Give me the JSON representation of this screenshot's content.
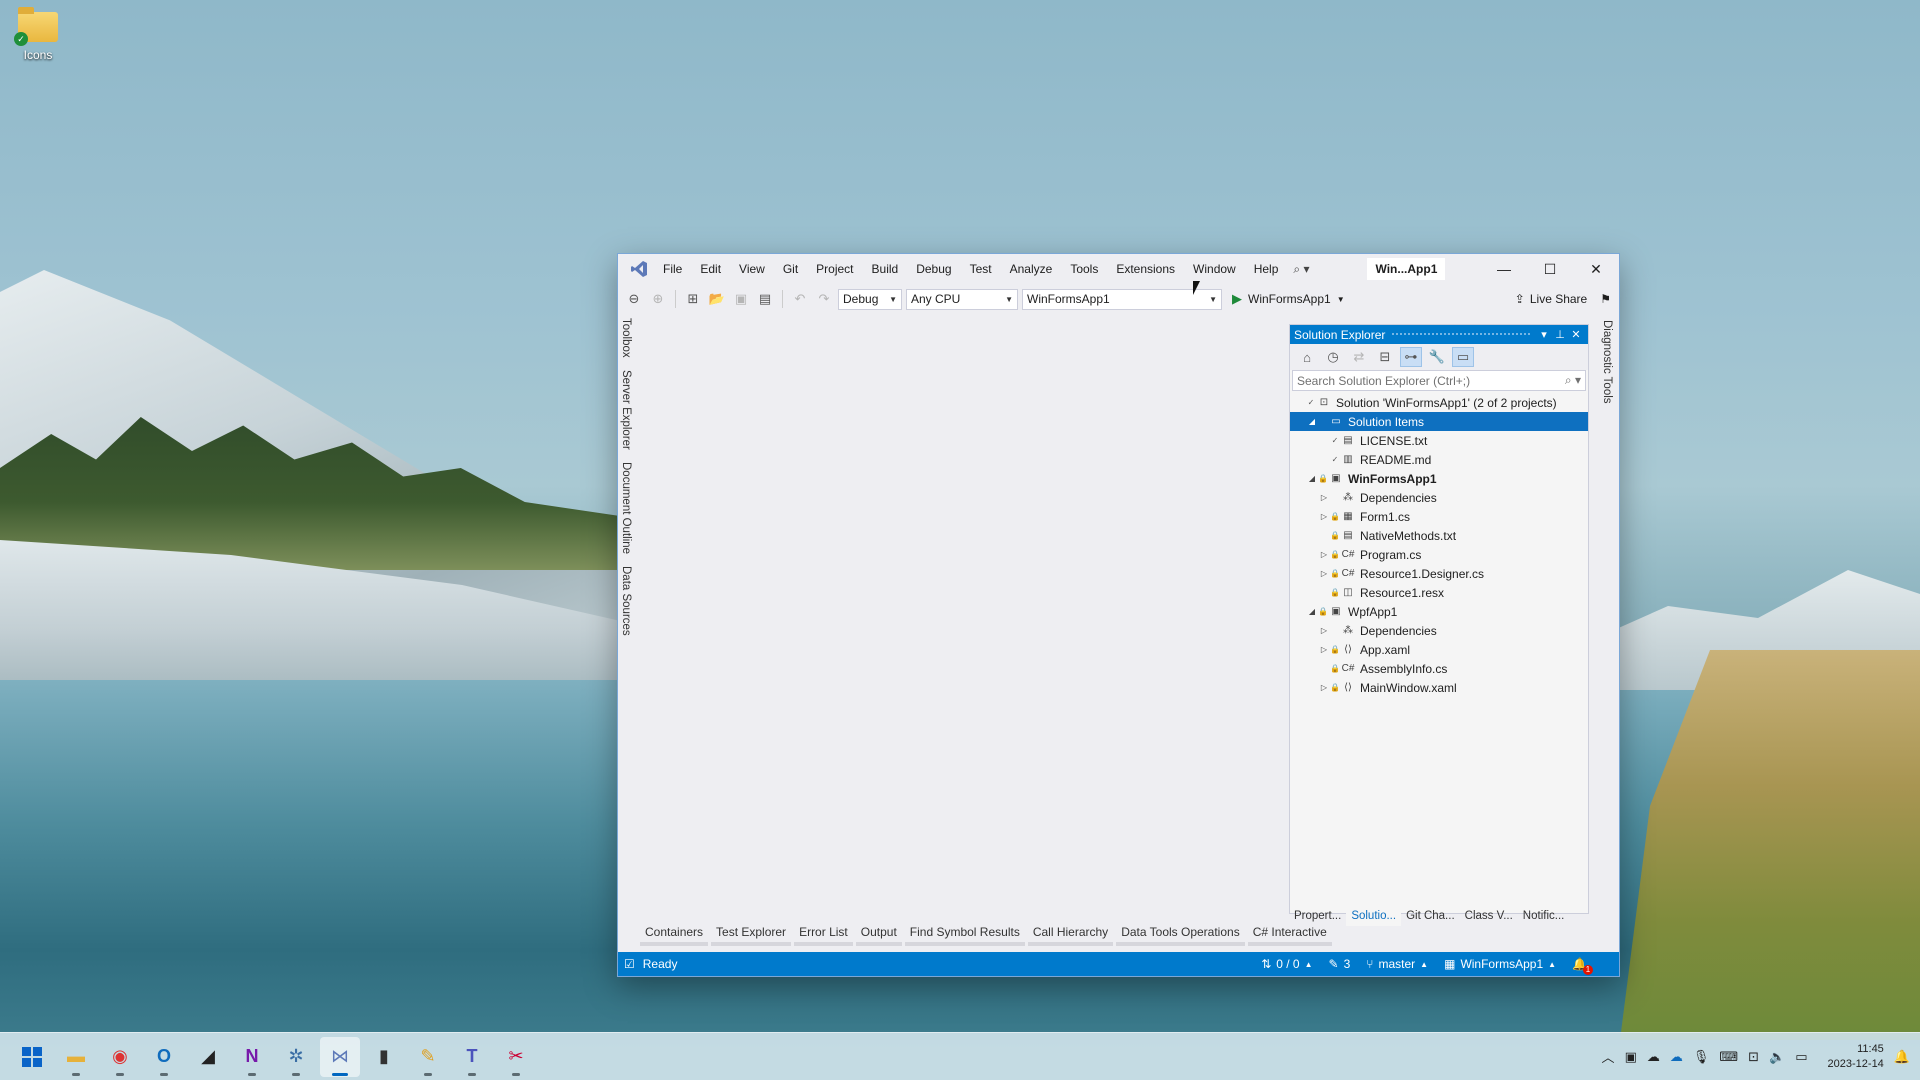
{
  "desktop": {
    "icon_label": "Icons"
  },
  "vs": {
    "menu": [
      "File",
      "Edit",
      "View",
      "Git",
      "Project",
      "Build",
      "Debug",
      "Test",
      "Analyze",
      "Tools",
      "Extensions",
      "Window",
      "Help"
    ],
    "title": "Win...App1",
    "toolbar": {
      "config": "Debug",
      "platform": "Any CPU",
      "startup_project": "WinFormsApp1",
      "run_target": "WinFormsApp1",
      "live_share": "Live Share"
    },
    "left_rail": [
      "Toolbox",
      "Server Explorer",
      "Document Outline",
      "Data Sources"
    ],
    "right_rail": [
      "Diagnostic Tools"
    ],
    "solution_explorer": {
      "title": "Solution Explorer",
      "search_placeholder": "Search Solution Explorer (Ctrl+;)",
      "tree": [
        {
          "label": "Solution 'WinFormsApp1' (2 of 2 projects)",
          "indent": 0,
          "expander": "",
          "icon": "⊡",
          "lock": "✓",
          "bold": false,
          "selected": false
        },
        {
          "label": "Solution Items",
          "indent": 1,
          "expander": "◢",
          "icon": "▭",
          "lock": "",
          "bold": false,
          "selected": true
        },
        {
          "label": "LICENSE.txt",
          "indent": 2,
          "expander": "",
          "icon": "▤",
          "lock": "✓",
          "bold": false,
          "selected": false
        },
        {
          "label": "README.md",
          "indent": 2,
          "expander": "",
          "icon": "▥",
          "lock": "✓",
          "bold": false,
          "selected": false
        },
        {
          "label": "WinFormsApp1",
          "indent": 1,
          "expander": "◢",
          "icon": "▣",
          "lock": "🔒",
          "bold": true,
          "selected": false
        },
        {
          "label": "Dependencies",
          "indent": 2,
          "expander": "▷",
          "icon": "⁂",
          "lock": "",
          "bold": false,
          "selected": false
        },
        {
          "label": "Form1.cs",
          "indent": 2,
          "expander": "▷",
          "icon": "▦",
          "lock": "🔒",
          "bold": false,
          "selected": false
        },
        {
          "label": "NativeMethods.txt",
          "indent": 2,
          "expander": "",
          "icon": "▤",
          "lock": "🔒",
          "bold": false,
          "selected": false
        },
        {
          "label": "Program.cs",
          "indent": 2,
          "expander": "▷",
          "icon": "C#",
          "lock": "🔒",
          "bold": false,
          "selected": false
        },
        {
          "label": "Resource1.Designer.cs",
          "indent": 2,
          "expander": "▷",
          "icon": "C#",
          "lock": "🔒",
          "bold": false,
          "selected": false
        },
        {
          "label": "Resource1.resx",
          "indent": 2,
          "expander": "",
          "icon": "◫",
          "lock": "🔒",
          "bold": false,
          "selected": false
        },
        {
          "label": "WpfApp1",
          "indent": 1,
          "expander": "◢",
          "icon": "▣",
          "lock": "🔒",
          "bold": false,
          "selected": false
        },
        {
          "label": "Dependencies",
          "indent": 2,
          "expander": "▷",
          "icon": "⁂",
          "lock": "",
          "bold": false,
          "selected": false
        },
        {
          "label": "App.xaml",
          "indent": 2,
          "expander": "▷",
          "icon": "⟨⟩",
          "lock": "🔒",
          "bold": false,
          "selected": false
        },
        {
          "label": "AssemblyInfo.cs",
          "indent": 2,
          "expander": "",
          "icon": "C#",
          "lock": "🔒",
          "bold": false,
          "selected": false
        },
        {
          "label": "MainWindow.xaml",
          "indent": 2,
          "expander": "▷",
          "icon": "⟨⟩",
          "lock": "🔒",
          "bold": false,
          "selected": false
        }
      ],
      "tabs": [
        "Propert...",
        "Solutio...",
        "Git Cha...",
        "Class V...",
        "Notific..."
      ],
      "active_tab": 1
    },
    "bottom_tabs": [
      "Containers",
      "Test Explorer",
      "Error List",
      "Output",
      "Find Symbol Results",
      "Call Hierarchy",
      "Data Tools Operations",
      "C# Interactive"
    ],
    "status": {
      "ready": "Ready",
      "commits": "0 / 0",
      "changes": "3",
      "branch": "master",
      "repo": "WinFormsApp1",
      "notification_count": "1"
    }
  },
  "taskbar": {
    "apps": [
      "start-icon",
      "file-explorer-icon",
      "chrome-icon",
      "outlook-icon",
      "terminal-preview-icon",
      "onenote-icon",
      "network-icon",
      "visual-studio-icon",
      "cmd-icon",
      "paint-icon",
      "teams-icon",
      "snipping-tool-icon"
    ],
    "time": "11:45",
    "date": "2023-12-14"
  }
}
